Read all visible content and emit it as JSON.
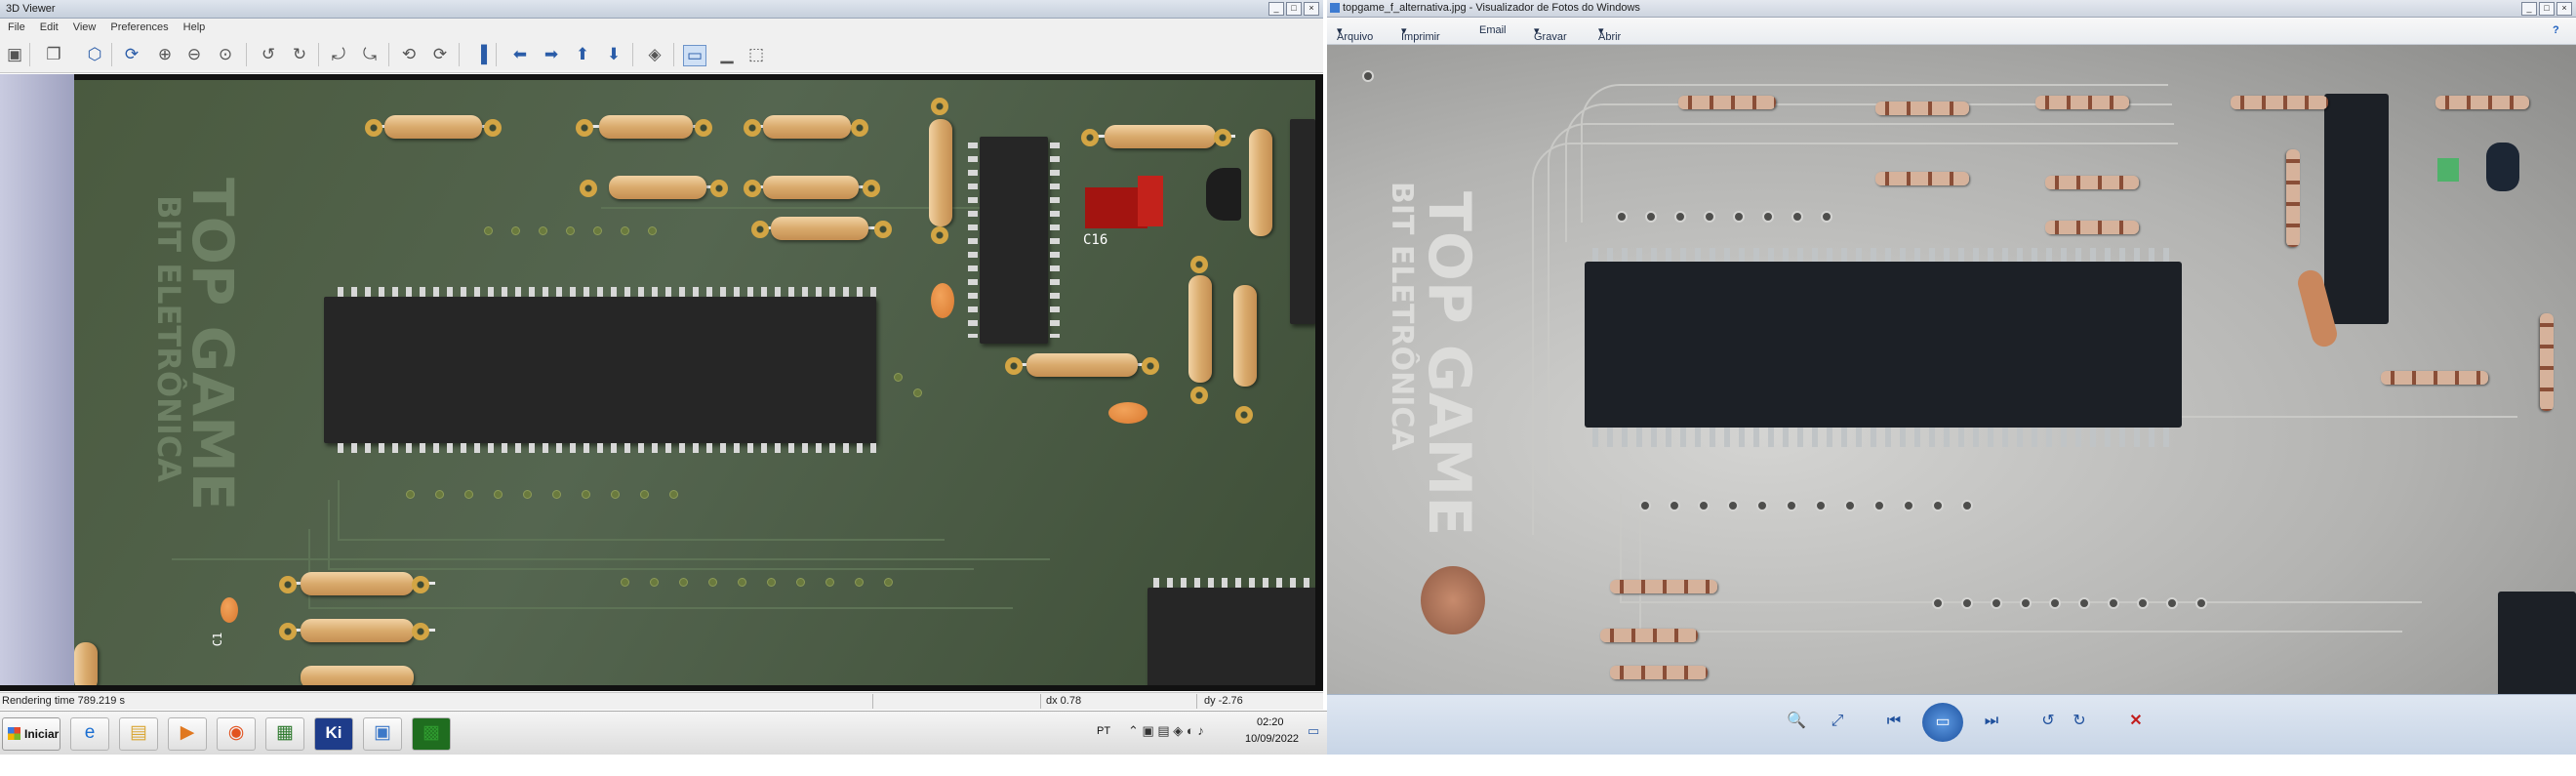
{
  "left_window": {
    "title": "3D Viewer",
    "menu": [
      "File",
      "Edit",
      "View",
      "Preferences",
      "Help"
    ],
    "toolbar_icons": [
      "reload-board-icon",
      "copy-icon",
      "board-view-icon",
      "refresh-icon",
      "zoom-in-icon",
      "zoom-out-icon",
      "zoom-fit-icon",
      "rotate-x-icon",
      "rotate-x-reverse-icon",
      "rotate-y-icon",
      "rotate-y-reverse-icon",
      "rotate-z-icon",
      "rotate-z-reverse-icon",
      "flip-icon",
      "pan-left-icon",
      "pan-right-icon",
      "pan-up-icon",
      "pan-down-icon",
      "box-icon",
      "ortho-icon",
      "grid-icon",
      "raytrace-icon"
    ],
    "viewport": {
      "silk_top": "TOP GAME",
      "silk_sub": "BIT ELETRÔNICA",
      "ref_c16": "C16",
      "ref_c1": "C1"
    },
    "status": {
      "render": "Rendering time 789.219 s",
      "dx": "dx 0.78",
      "dy": "dy -2.76"
    }
  },
  "taskbar": {
    "start": "Iniciar",
    "apps": [
      "ie-icon",
      "explorer-icon",
      "media-player-icon",
      "firefox-icon",
      "pcb-editor-icon",
      "kicad-icon",
      "photo-viewer-icon",
      "gerber-icon"
    ],
    "lang": "PT",
    "time": "02:20",
    "date": "10/09/2022"
  },
  "right_window": {
    "title": "topgame_f_alternativa.jpg - Visualizador de Fotos do Windows",
    "menu": [
      "Arquivo",
      "Imprimir",
      "Email",
      "Gravar",
      "Abrir"
    ],
    "photo": {
      "silk_top": "TOP GAME",
      "silk_sub": "BIT ELETRÔNICA"
    },
    "controls": [
      "zoom-icon",
      "fit-window-icon",
      "previous-icon",
      "slideshow-icon",
      "next-icon",
      "rotate-left-icon",
      "rotate-right-icon",
      "delete-icon"
    ]
  }
}
